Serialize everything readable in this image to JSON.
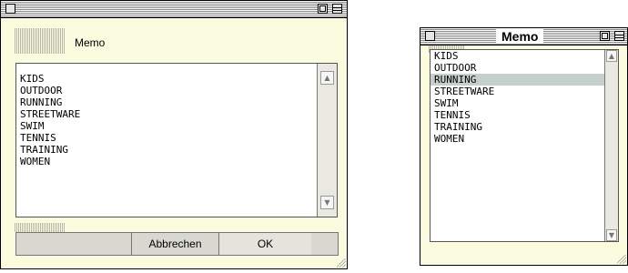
{
  "left_window": {
    "title": "",
    "label": "Memo",
    "items": [
      "KIDS",
      "OUTDOOR",
      "RUNNING",
      "STREETWARE",
      "SWIM",
      "TENNIS",
      "TRAINING",
      "WOMEN"
    ],
    "buttons": {
      "cancel": "Abbrechen",
      "ok": "OK"
    }
  },
  "right_window": {
    "title": "Memo",
    "items": [
      "KIDS",
      "OUTDOOR",
      "RUNNING",
      "STREETWARE",
      "SWIM",
      "TENNIS",
      "TRAINING",
      "WOMEN"
    ],
    "selected_item": "RUNNING"
  },
  "icons": {
    "close": "close-box-icon",
    "zoom": "zoom-box-icon",
    "collapse": "collapse-box-icon",
    "scroll_up": "scroll-up-arrow-icon",
    "scroll_down": "scroll-down-arrow-icon",
    "resize": "resize-grip-icon"
  },
  "colors": {
    "window_bg": "#fbfbe0",
    "selection": "#c5d0cc"
  }
}
